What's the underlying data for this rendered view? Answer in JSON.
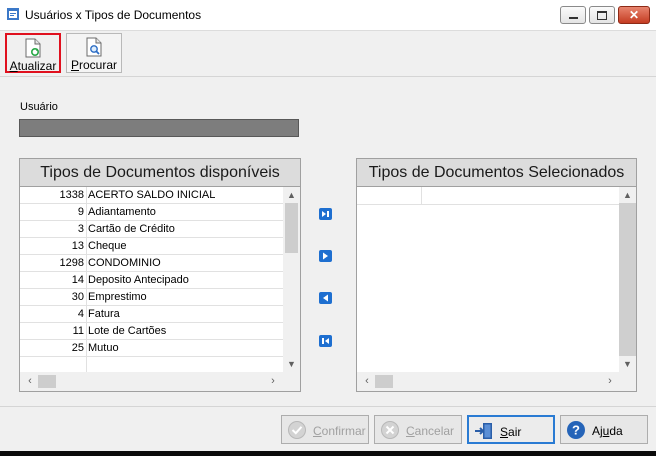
{
  "window": {
    "title": "Usuários x Tipos de Documentos"
  },
  "toolbar": {
    "refresh_label_mnemonic": "A",
    "refresh_label_rest": "tualizar",
    "search_label_mnemonic": "P",
    "search_label_rest": "rocurar"
  },
  "user": {
    "label": "Usuário",
    "value": ""
  },
  "available": {
    "header": "Tipos de Documentos disponíveis",
    "items": [
      {
        "code": "1338",
        "name": "ACERTO SALDO INICIAL"
      },
      {
        "code": "9",
        "name": "Adiantamento"
      },
      {
        "code": "3",
        "name": "Cartão de Crédito"
      },
      {
        "code": "13",
        "name": "Cheque"
      },
      {
        "code": "1298",
        "name": "CONDOMINIO"
      },
      {
        "code": "14",
        "name": "Deposito Antecipado"
      },
      {
        "code": "30",
        "name": "Emprestimo"
      },
      {
        "code": "4",
        "name": "Fatura"
      },
      {
        "code": "11",
        "name": "Lote de Cartões"
      },
      {
        "code": "25",
        "name": "Mutuo"
      }
    ]
  },
  "selected": {
    "header": "Tipos de Documentos Selecionados"
  },
  "footer": {
    "confirm_mnemonic": "C",
    "confirm_rest": "onfirmar",
    "cancel_mnemonic": "C",
    "cancel_rest": "ancelar",
    "exit_mnemonic": "S",
    "exit_rest": "air",
    "help_before": "Aj",
    "help_mnemonic": "u",
    "help_after": "da"
  },
  "colors": {
    "accent": "#1e6fd0",
    "highlight_border": "#e0101e",
    "user_field": "#7d7d7d"
  },
  "icons": {
    "app": "app-window-icon",
    "refresh": "refresh-document-icon",
    "search": "search-document-icon",
    "add_all": "move-all-right-icon",
    "add": "move-right-icon",
    "remove": "move-left-icon",
    "remove_all": "move-all-left-icon",
    "confirm": "check-circle-icon",
    "cancel": "cancel-circle-icon",
    "exit": "exit-door-icon",
    "help": "help-question-icon"
  }
}
